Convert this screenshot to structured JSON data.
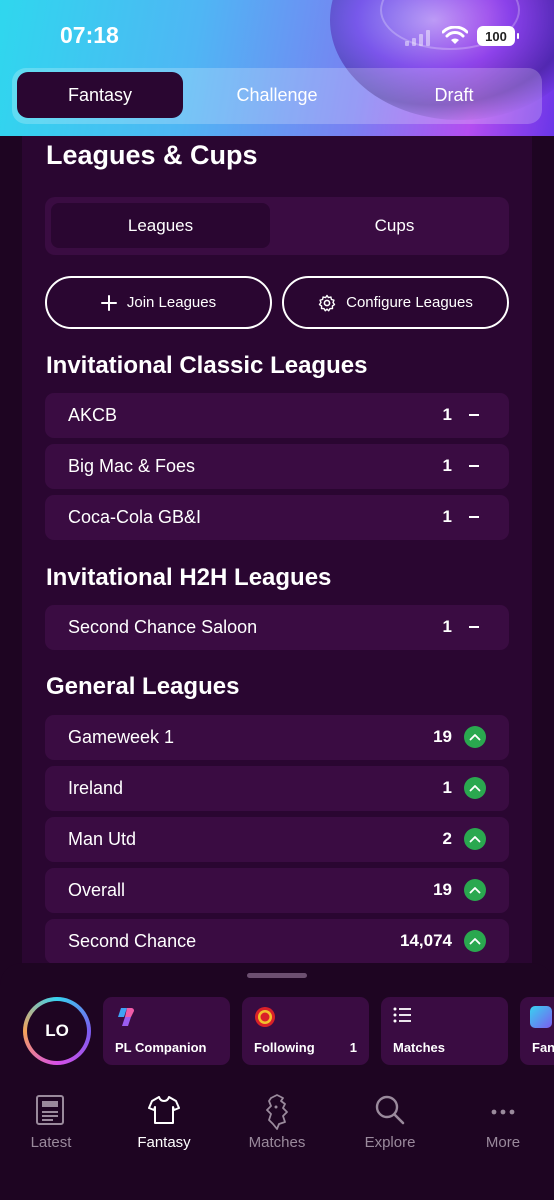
{
  "status_bar": {
    "time": "07:18",
    "battery": "100"
  },
  "top_tabs": [
    {
      "label": "Fantasy",
      "active": true
    },
    {
      "label": "Challenge",
      "active": false
    },
    {
      "label": "Draft",
      "active": false
    }
  ],
  "page_title": "Leagues & Cups",
  "segment": {
    "leagues": "Leagues",
    "cups": "Cups"
  },
  "actions": {
    "join": "Join Leagues",
    "configure": "Configure Leagues"
  },
  "sections": {
    "classic": {
      "title": "Invitational Classic Leagues",
      "rows": [
        {
          "name": "AKCB",
          "rank": "1"
        },
        {
          "name": "Big Mac & Foes",
          "rank": "1"
        },
        {
          "name": "Coca-Cola GB&I",
          "rank": "1"
        }
      ]
    },
    "h2h": {
      "title": "Invitational H2H Leagues",
      "rows": [
        {
          "name": "Second Chance Saloon",
          "rank": "1"
        }
      ]
    },
    "general": {
      "title": "General Leagues",
      "rows": [
        {
          "name": "Gameweek 1",
          "rank": "19"
        },
        {
          "name": "Ireland",
          "rank": "1"
        },
        {
          "name": "Man Utd",
          "rank": "2"
        },
        {
          "name": "Overall",
          "rank": "19"
        },
        {
          "name": "Second Chance",
          "rank": "14,074"
        }
      ]
    }
  },
  "bottom_sheet": {
    "avatar_initials": "LO",
    "cards": [
      {
        "label": "PL Companion",
        "icon": "copilot-icon"
      },
      {
        "label": "Following",
        "count": "1",
        "icon": "man-utd-crest-icon"
      },
      {
        "label": "Matches",
        "icon": "list-icon"
      },
      {
        "label": "Fan",
        "icon": "pl-app-icon"
      }
    ]
  },
  "bottom_nav": [
    {
      "label": "Latest",
      "icon": "newspaper-icon"
    },
    {
      "label": "Fantasy",
      "icon": "shirt-icon",
      "active": true
    },
    {
      "label": "Matches",
      "icon": "lion-icon"
    },
    {
      "label": "Explore",
      "icon": "search-icon"
    },
    {
      "label": "More",
      "icon": "more-icon"
    }
  ],
  "colors": {
    "background": "#1e0522",
    "panel": "#2a0631",
    "row": "#3a0c42",
    "up_arrow": "#2aa84f"
  }
}
